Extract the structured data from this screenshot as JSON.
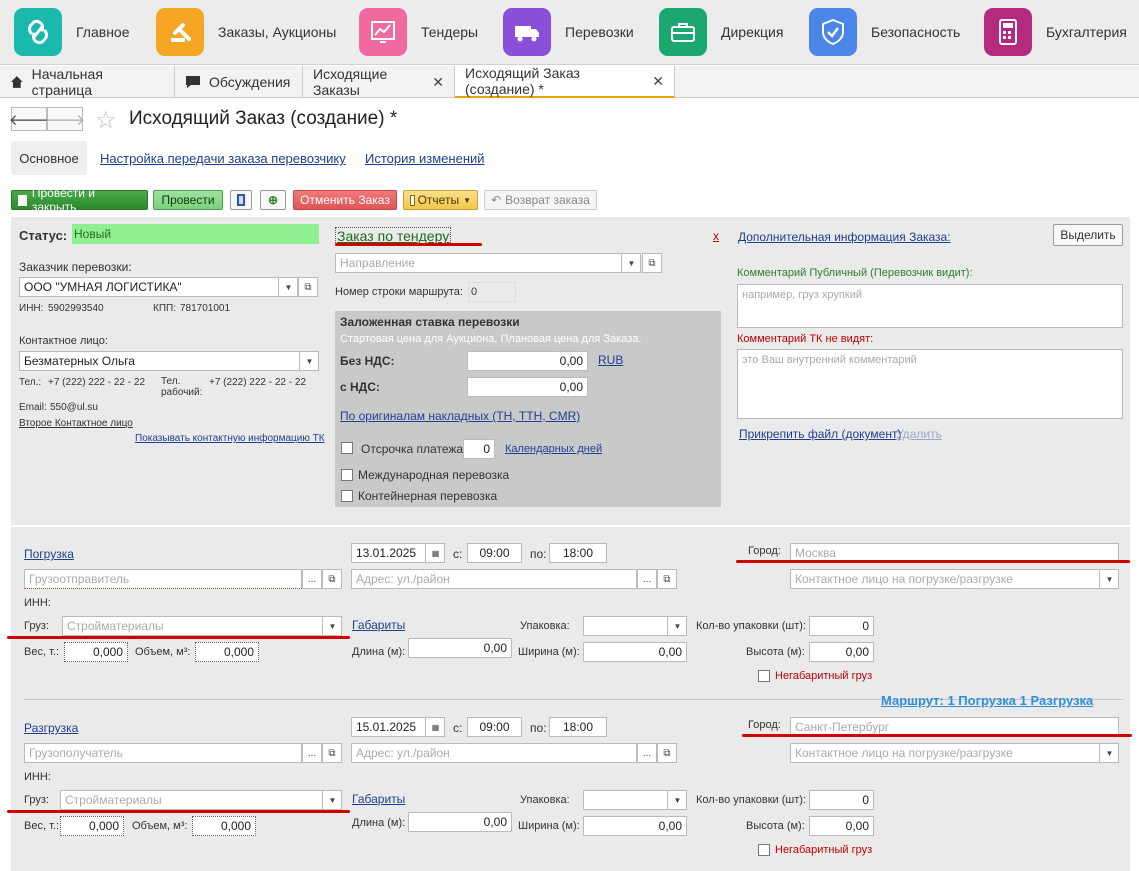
{
  "sections": [
    {
      "label": "Главное",
      "icon": "link-icon",
      "color": "#1bb8ad"
    },
    {
      "label": "Заказы, Аукционы",
      "icon": "gavel-icon",
      "color": "#f5a623"
    },
    {
      "label": "Тендеры",
      "icon": "chart-icon",
      "color": "#f06aa0"
    },
    {
      "label": "Перевозки",
      "icon": "truck-icon",
      "color": "#8a4fd8"
    },
    {
      "label": "Дирекция",
      "icon": "briefcase-icon",
      "color": "#1aa86f"
    },
    {
      "label": "Безопасность",
      "icon": "shield-icon",
      "color": "#4a86e8"
    },
    {
      "label": "Бухгалтерия",
      "icon": "calculator-icon",
      "color": "#b42a7e"
    }
  ],
  "tabs": [
    {
      "label": "Начальная страница"
    },
    {
      "label": "Обсуждения"
    },
    {
      "label": "Исходящие Заказы"
    },
    {
      "label": "Исходящий Заказ (создание) *"
    }
  ],
  "title": "Исходящий Заказ (создание) *",
  "form_tabs": {
    "main": "Основное",
    "transfer": "Настройка передачи заказа перевозчику",
    "history": "История изменений"
  },
  "toolbar": {
    "post_close": "Провести и закрыть",
    "post": "Провести",
    "cancel": "Отменить Заказ",
    "reports": "Отчеты",
    "return": "Возврат заказа"
  },
  "status": {
    "label": "Статус:",
    "value": "Новый"
  },
  "tender": {
    "label": "Заказ по тендеру",
    "close": "x"
  },
  "extra_info": "Дополнительная информация Заказа:",
  "select_btn": "Выделить",
  "customer": {
    "label": "Заказчик перевозки:",
    "value": "ООО \"УМНАЯ ЛОГИСТИКА\"",
    "inn_label": "ИНН:",
    "inn": "5902993540",
    "kpp_label": "КПП:",
    "kpp": "781701001"
  },
  "contact": {
    "label": "Контактное лицо:",
    "value": "Безматерных Ольга",
    "tel_label": "Тел.:",
    "tel": "+7 (222) 222 - 22 - 22",
    "work_label": "Тел. рабочий:",
    "work": "+7 (222) 222 - 22 - 22",
    "email_label": "Email:",
    "email": "550@ul.su",
    "second": "Второе Контактное лицо",
    "show_tk": "Показывать контактную информацию ТК"
  },
  "direction_ph": "Направление",
  "route_no": {
    "label": "Номер строки маршрута:",
    "value": "0"
  },
  "rate": {
    "title": "Заложенная ставка перевозки",
    "subtitle": "Стартовая цена для Аукциона, Плановая цена для Заказа.",
    "no_vat_label": "Без НДС:",
    "no_vat": "0,00",
    "currency": "RUB",
    "vat_label": "с НДС:",
    "vat": "0,00",
    "originals": "По оригиналам накладных (ТН, ТТН, CMR)",
    "deferral_label": "Отсрочка платежа:",
    "deferral": "0",
    "days": "Календарных дней",
    "intl": "Международная перевозка",
    "container": "Контейнерная перевозка"
  },
  "comments": {
    "public_label": "Комментарий Публичный (Перевозчик видит):",
    "public_ph": "например, груз хрупкий",
    "private_label": "Комментарий ТК не видят:",
    "private_ph": "это Ваш внутренний комментарий",
    "attach": "Прикрепить файл (документ)",
    "delete": "Удалить"
  },
  "loading": {
    "label": "Погрузка",
    "date": "13.01.2025",
    "from_label": "с:",
    "from": "09:00",
    "to_label": "по:",
    "to": "18:00",
    "city_label": "Город:",
    "city_ph": "Москва",
    "party_ph": "Грузоотправитель",
    "address_ph": "Адрес: ул./район",
    "contact_ph": "Контактное лицо на погрузке/разгрузке",
    "inn_label": "ИНН:",
    "cargo_label": "Груз:",
    "cargo_ph": "Стройматериалы",
    "dims": "Габариты",
    "pack_label": "Упаковка:",
    "qty_label": "Кол-во упаковки (шт):",
    "qty": "0",
    "weight_label": "Вес, т.:",
    "weight": "0,000",
    "volume_label": "Объем, м³:",
    "volume": "0,000",
    "length_label": "Длина (м):",
    "length": "0,00",
    "width_label": "Ширина (м):",
    "width": "0,00",
    "height_label": "Высота (м):",
    "height": "0,00",
    "oversize": "Негабаритный груз"
  },
  "route_summary": "Маршрут:  1 Погрузка  1 Разгрузка",
  "unloading": {
    "label": "Разгрузка",
    "date": "15.01.2025",
    "from_label": "с:",
    "from": "09:00",
    "to_label": "по:",
    "to": "18:00",
    "city_label": "Город:",
    "city_ph": "Санкт-Петербург",
    "party_ph": "Грузополучатель",
    "address_ph": "Адрес: ул./район",
    "contact_ph": "Контактное лицо на погрузке/разгрузке",
    "inn_label": "ИНН:",
    "cargo_label": "Груз:",
    "cargo_ph": "Стройматериалы",
    "dims": "Габариты",
    "pack_label": "Упаковка:",
    "qty_label": "Кол-во упаковки (шт):",
    "qty": "0",
    "weight_label": "Вес, т.:",
    "weight": "0,000",
    "volume_label": "Объем, м³:",
    "volume": "0,000",
    "length_label": "Длина (м):",
    "length": "0,00",
    "width_label": "Ширина (м):",
    "width": "0,00",
    "height_label": "Высота (м):",
    "height": "0,00",
    "oversize": "Негабаритный груз"
  }
}
